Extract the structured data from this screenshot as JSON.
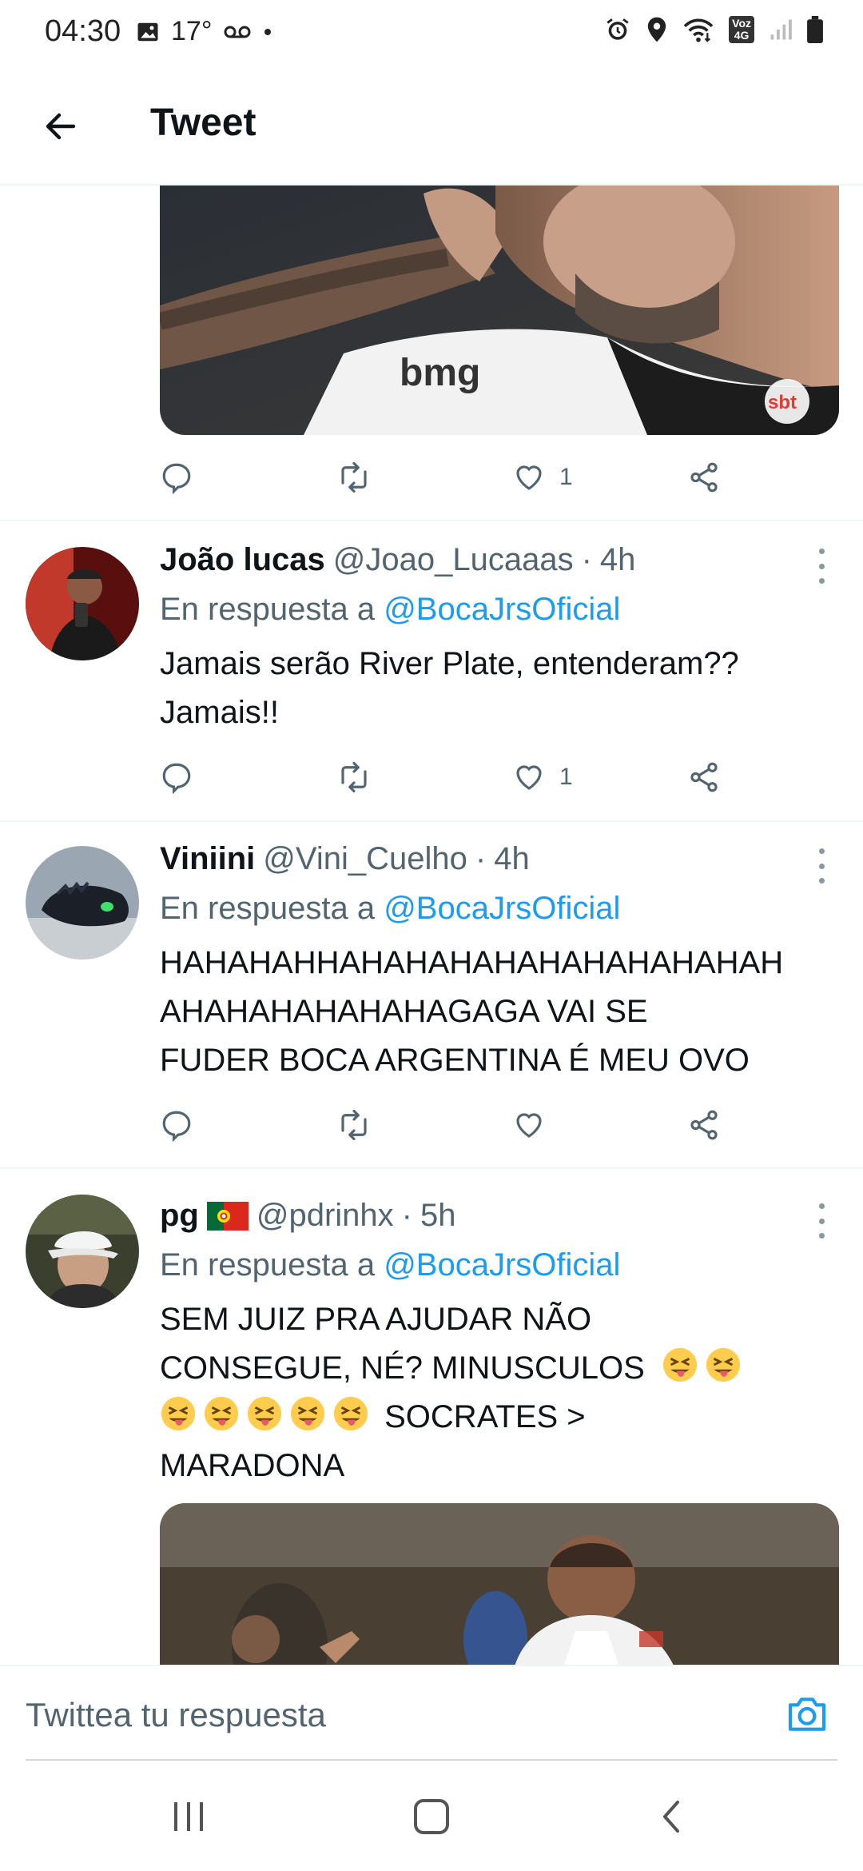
{
  "status_bar": {
    "time": "04:30",
    "temperature": "17°",
    "icons_left": [
      "image-icon",
      "voicemail-icon",
      "dot-icon"
    ],
    "icons_right": [
      "alarm-icon",
      "location-icon",
      "wifi-icon",
      "volte-icon",
      "signal-icon",
      "battery-icon"
    ],
    "volte_line1": "Voz",
    "volte_line2": "4G"
  },
  "header": {
    "title": "Tweet"
  },
  "top_tweet_actions": {
    "like_count": "1"
  },
  "tweets": [
    {
      "name": "João lucas",
      "handle": "@Joao_Lucaaas",
      "separator": "·",
      "time": "4h",
      "reply_prefix": "En respuesta a",
      "reply_mention": "@BocaJrsOficial",
      "text_lines": [
        "Jamais serão River Plate, entenderam??",
        "Jamais!!"
      ],
      "like_count": "1"
    },
    {
      "name": "Viniini",
      "handle": "@Vini_Cuelho",
      "separator": "·",
      "time": "4h",
      "reply_prefix": "En respuesta a",
      "reply_mention": "@BocaJrsOficial",
      "text_lines": [
        "HAHAHAHHAHAHAHAHAHAHAHAHAHAH",
        "AHAHAHAHAHAHAGAGA VAI SE",
        "FUDER BOCA ARGENTINA É MEU OVO"
      ],
      "like_count": ""
    },
    {
      "name": "pg",
      "handle": "@pdrinhx",
      "separator": "·",
      "time": "5h",
      "reply_prefix": "En respuesta a",
      "reply_mention": "@BocaJrsOficial",
      "text_line1": "SEM JUIZ PRA AJUDAR NÃO",
      "text_line2": "CONSEGUE, NÉ? MINUSCULOS",
      "text_line3": "SOCRATES >",
      "text_line4": "MARADONA"
    }
  ],
  "composer": {
    "placeholder": "Twittea tu respuesta"
  },
  "colors": {
    "accent": "#1d9bf0",
    "secondary_text": "#536471",
    "primary_text": "#0f1419",
    "divider": "#eff3f4"
  }
}
